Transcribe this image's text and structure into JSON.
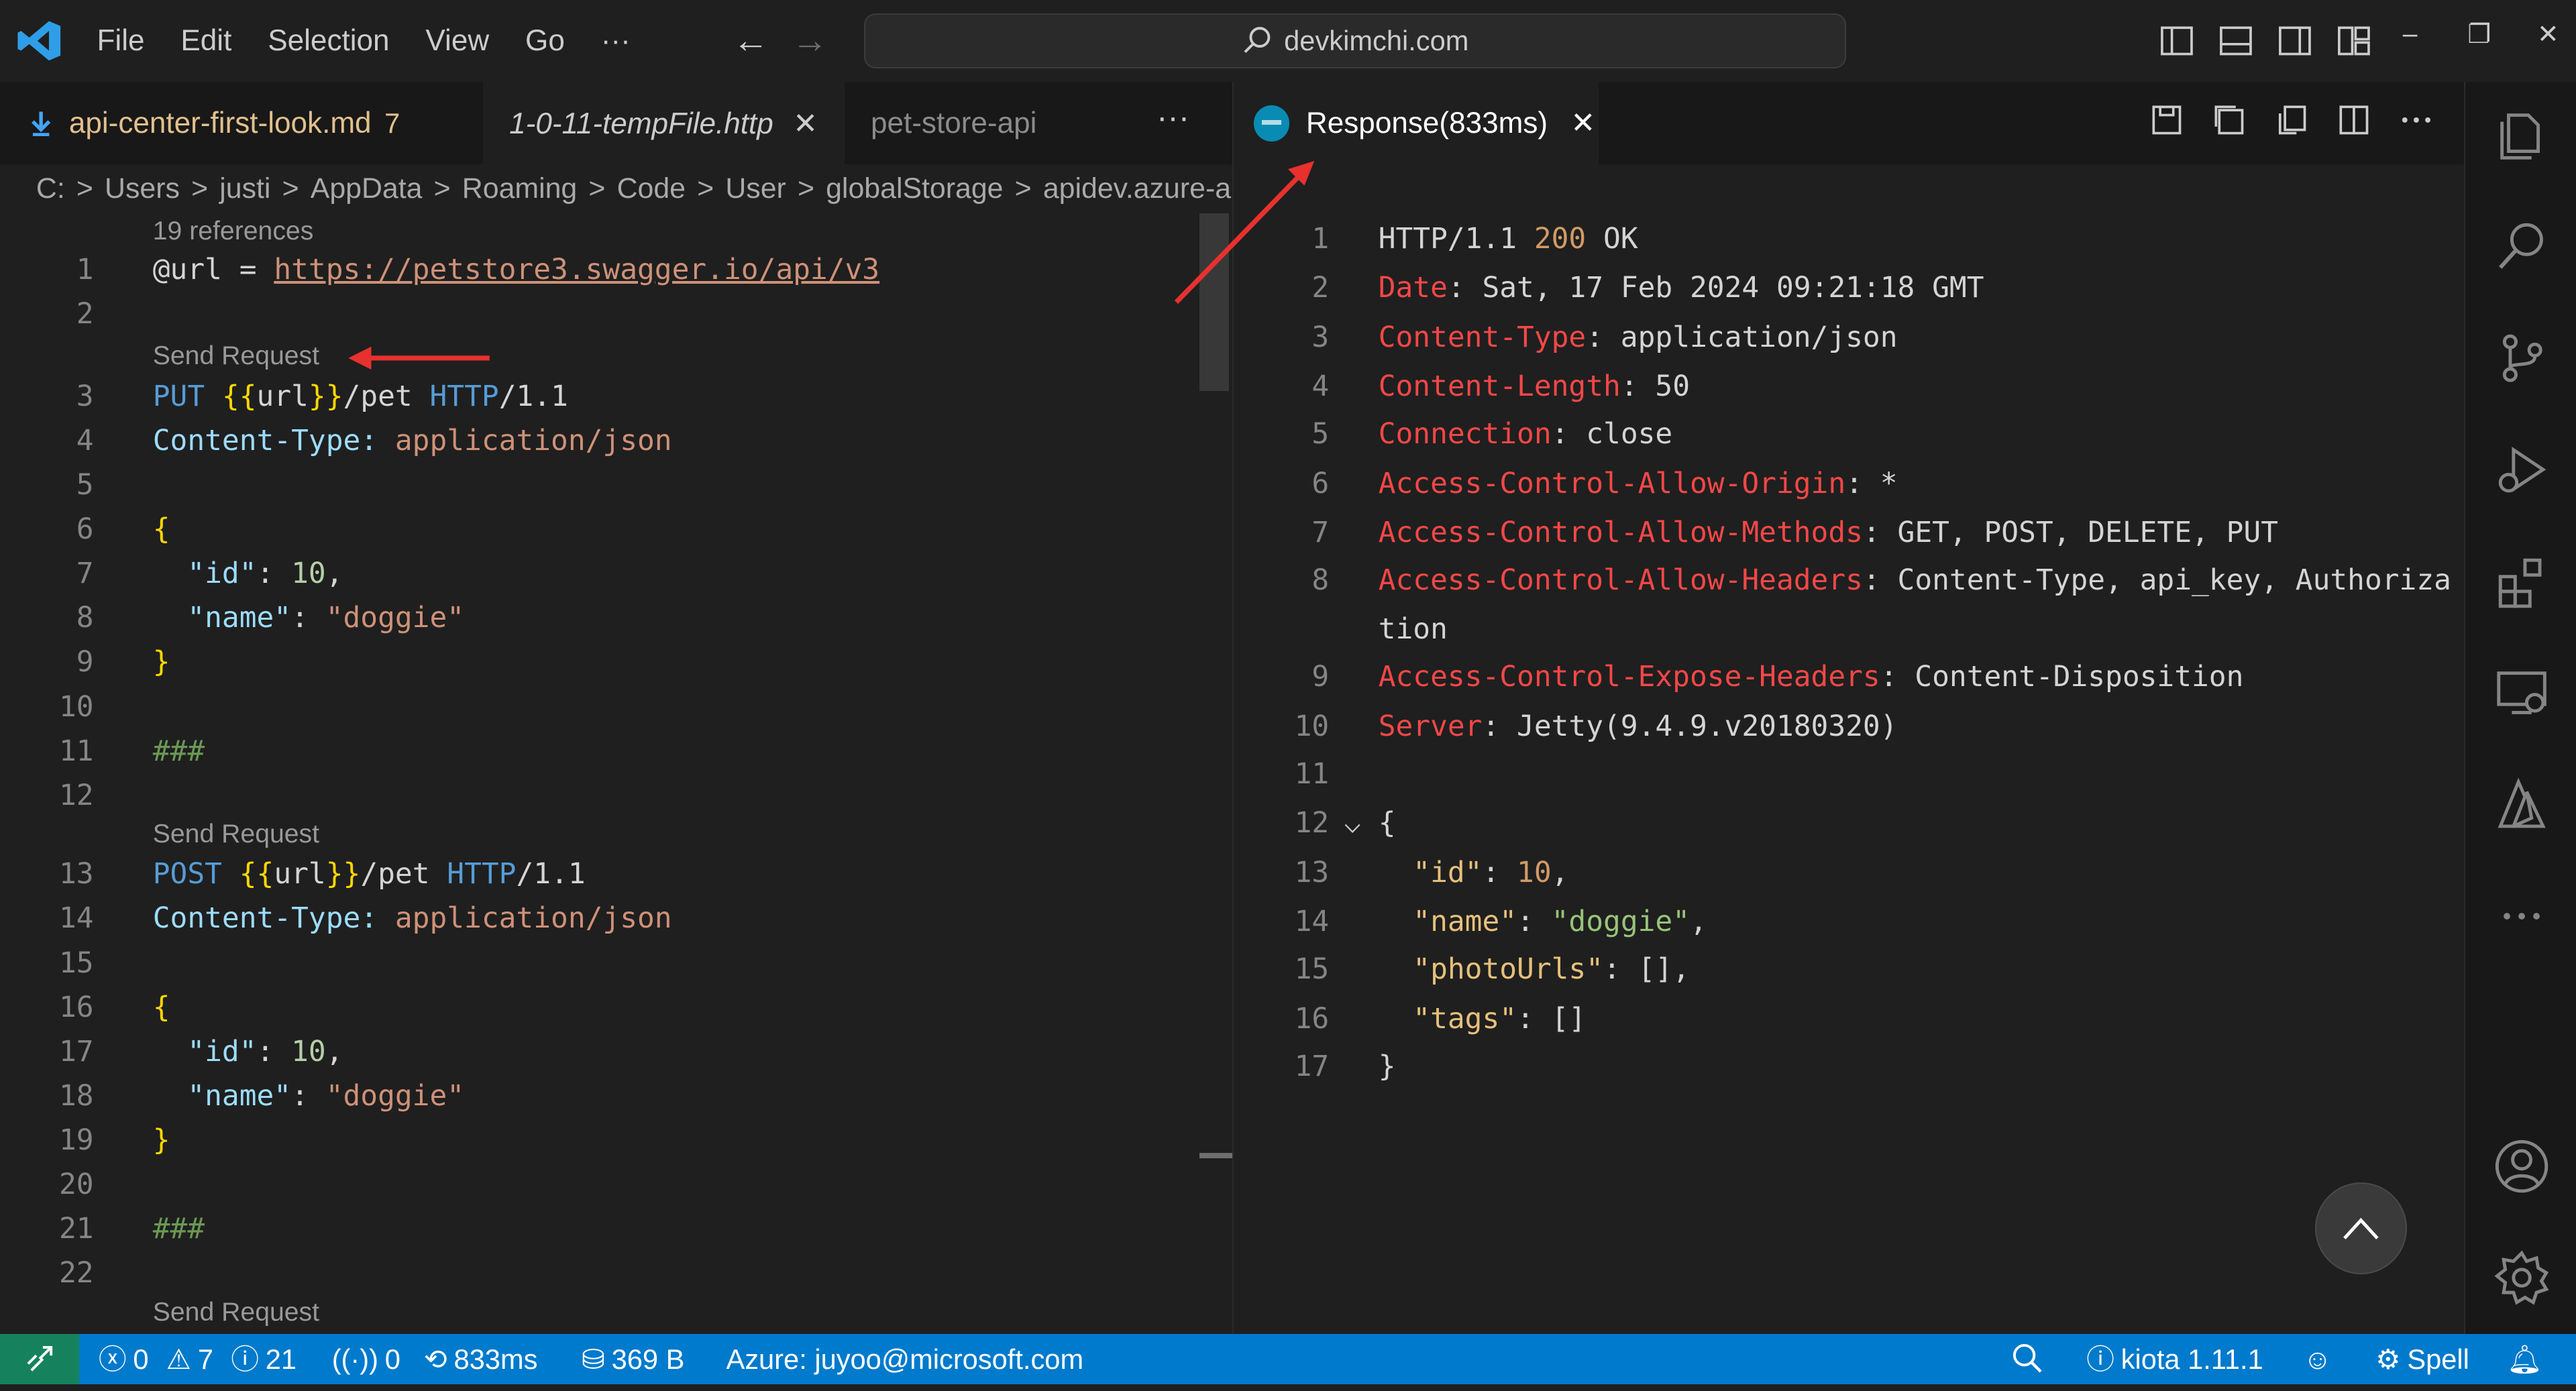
{
  "menu": [
    "File",
    "Edit",
    "Selection",
    "View",
    "Go",
    "···"
  ],
  "search": {
    "label": "devkimchi.com"
  },
  "tabs_left": [
    {
      "label": "api-center-first-look.md",
      "badge": "7"
    },
    {
      "label": "1-0-11-tempFile.http",
      "close": "✕"
    },
    {
      "label": "pet-store-api"
    }
  ],
  "tabs_left_more": "···",
  "breadcrumb": [
    "C:",
    "Users",
    "justi",
    "AppData",
    "Roaming",
    "Code",
    "User",
    "globalStorage",
    "apidev.azure-a"
  ],
  "breadcrumb_sep": ">",
  "codelens": {
    "references": "19 references",
    "send_request": "Send Request"
  },
  "left_lines": [
    {
      "n": "1",
      "code": "@url = https://petstore3.swagger.io/api/v3"
    },
    {
      "n": "2",
      "code": ""
    },
    {
      "n": "3",
      "code": "PUT {{url}}/pet HTTP/1.1"
    },
    {
      "n": "4",
      "code": "Content-Type: application/json"
    },
    {
      "n": "5",
      "code": ""
    },
    {
      "n": "6",
      "code": "{"
    },
    {
      "n": "7",
      "code": "  \"id\": 10,"
    },
    {
      "n": "8",
      "code": "  \"name\": \"doggie\""
    },
    {
      "n": "9",
      "code": "}"
    },
    {
      "n": "10",
      "code": ""
    },
    {
      "n": "11",
      "code": "###"
    },
    {
      "n": "12",
      "code": ""
    },
    {
      "n": "13",
      "code": "POST {{url}}/pet HTTP/1.1"
    },
    {
      "n": "14",
      "code": "Content-Type: application/json"
    },
    {
      "n": "15",
      "code": ""
    },
    {
      "n": "16",
      "code": "{"
    },
    {
      "n": "17",
      "code": "  \"id\": 10,"
    },
    {
      "n": "18",
      "code": "  \"name\": \"doggie\""
    },
    {
      "n": "19",
      "code": "}"
    },
    {
      "n": "20",
      "code": ""
    },
    {
      "n": "21",
      "code": "###"
    },
    {
      "n": "22",
      "code": ""
    }
  ],
  "right_tab": {
    "label": "Response(833ms)",
    "close": "✕"
  },
  "right_lines": [
    {
      "n": "1",
      "code": "HTTP/1.1 200 OK"
    },
    {
      "n": "2",
      "code": "Date: Sat, 17 Feb 2024 09:21:18 GMT"
    },
    {
      "n": "3",
      "code": "Content-Type: application/json"
    },
    {
      "n": "4",
      "code": "Content-Length: 50"
    },
    {
      "n": "5",
      "code": "Connection: close"
    },
    {
      "n": "6",
      "code": "Access-Control-Allow-Origin: *"
    },
    {
      "n": "7",
      "code": "Access-Control-Allow-Methods: GET, POST, DELETE, PUT"
    },
    {
      "n": "8",
      "code": "Access-Control-Allow-Headers: Content-Type, api_key, Authoriza"
    },
    {
      "n": "",
      "code": "tion"
    },
    {
      "n": "9",
      "code": "Access-Control-Expose-Headers: Content-Disposition"
    },
    {
      "n": "10",
      "code": "Server: Jetty(9.4.9.v20180320)"
    },
    {
      "n": "11",
      "code": ""
    },
    {
      "n": "12",
      "code": "{"
    },
    {
      "n": "13",
      "code": "  \"id\": 10,"
    },
    {
      "n": "14",
      "code": "  \"name\": \"doggie\","
    },
    {
      "n": "15",
      "code": "  \"photoUrls\": [],"
    },
    {
      "n": "16",
      "code": "  \"tags\": []"
    },
    {
      "n": "17",
      "code": "}"
    }
  ],
  "fold_glyph": "⌵",
  "status": {
    "errors": "0",
    "warnings": "7",
    "infos": "21",
    "ports": "0",
    "timing": "833ms",
    "size": "369 B",
    "account": "Azure: juyoo@microsoft.com",
    "kiota": "kiota 1.11.1",
    "spell": "Spell"
  },
  "colors": {
    "accent": "#007acc",
    "remote": "#16825d",
    "annotation_arrow": "#e8312e"
  },
  "icons": {
    "activity": [
      "explorer-icon",
      "search-icon",
      "source-control-icon",
      "run-debug-icon",
      "extensions-icon",
      "remote-explorer-icon",
      "azure-icon",
      "more-icon",
      "accounts-icon",
      "settings-gear-icon"
    ]
  }
}
